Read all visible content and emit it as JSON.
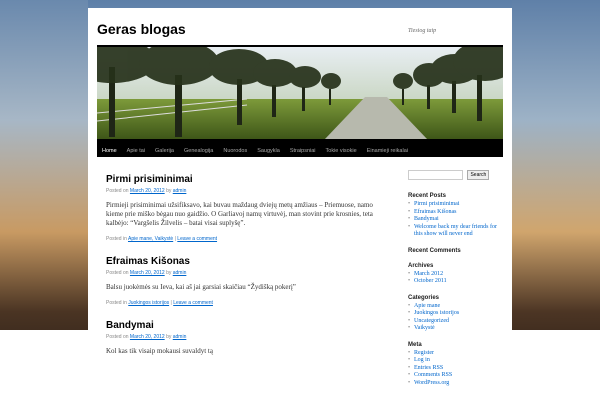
{
  "site": {
    "title": "Geras blogas",
    "description": "Tiesiog taip"
  },
  "nav": {
    "items": [
      "Home",
      "Apie tai",
      "Galerija",
      "Genealogija",
      "Nuorodos",
      "Saugykla",
      "Straipsniai",
      "Tokie visokie",
      "Einamieji reikalai"
    ]
  },
  "posts": [
    {
      "title": "Pirmi prisiminimai",
      "meta_prefix": "Posted on",
      "date": "March 20, 2012",
      "by": "by",
      "author": "admin",
      "body": "Pirmieji prisiminimai užsifiksavo, kai buvau maždaug dviejų metų amžiaus – Priemuose, namo kieme prie miško bėgau nuo gaidžio. O Garliavoj namų virtuvėj, man stovint prie krosnies, teta kalbėjo: “Vargšelis Žilvelis – batai visai suplyšę”.",
      "posted_in": "Posted in",
      "categories": "Apie mane, Vaikystė",
      "sep": "|",
      "comment": "Leave a comment"
    },
    {
      "title": "Efraimas Kišonas",
      "meta_prefix": "Posted on",
      "date": "March 20, 2012",
      "by": "by",
      "author": "admin",
      "body": "Balsu juokėmės su Ieva, kai aš jai garsiai skaičiau “Žydišką pokerį”",
      "posted_in": "Posted in",
      "categories": "Juokingos istorijos",
      "sep": "|",
      "comment": "Leave a comment"
    },
    {
      "title": "Bandymai",
      "meta_prefix": "Posted on",
      "date": "March 20, 2012",
      "by": "by",
      "author": "admin",
      "body": "Kol kas tik visaip mokausi suvaldyt tą"
    }
  ],
  "sidebar": {
    "search_button": "Search",
    "recent_posts": {
      "title": "Recent Posts",
      "items": [
        "Pirmi prisiminimai",
        "Efraimas Kišonas",
        "Bandymai",
        "Welcome back my dear friends for this show will never end"
      ]
    },
    "recent_comments": {
      "title": "Recent Comments"
    },
    "archives": {
      "title": "Archives",
      "items": [
        "March 2012",
        "October 2011"
      ]
    },
    "categories": {
      "title": "Categories",
      "items": [
        "Apie mane",
        "Juokingos istorijos",
        "Uncategorized",
        "Vaikystė"
      ]
    },
    "meta": {
      "title": "Meta",
      "items": [
        "Register",
        "Log in",
        "Entries RSS",
        "Comments RSS",
        "WordPress.org"
      ]
    }
  }
}
